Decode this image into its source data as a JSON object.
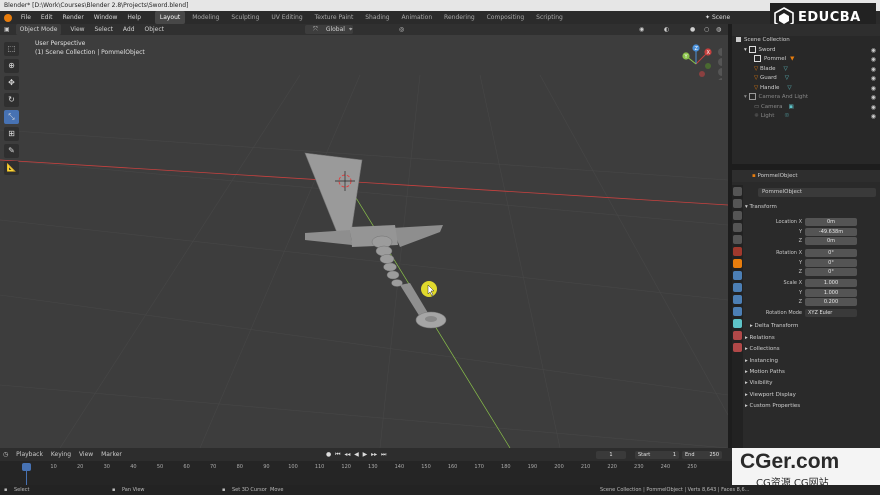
{
  "titlebar": {
    "text": "Blender* [D:\\Work\\Courses\\Blender 2.8\\Projects\\Sword.blend]"
  },
  "menu": [
    "File",
    "Edit",
    "Render",
    "Window",
    "Help"
  ],
  "workspaces": [
    {
      "label": "Layout",
      "active": true
    },
    {
      "label": "Modeling",
      "active": false
    },
    {
      "label": "Sculpting",
      "active": false
    },
    {
      "label": "UV Editing",
      "active": false
    },
    {
      "label": "Texture Paint",
      "active": false
    },
    {
      "label": "Shading",
      "active": false
    },
    {
      "label": "Animation",
      "active": false
    },
    {
      "label": "Rendering",
      "active": false
    },
    {
      "label": "Compositing",
      "active": false
    },
    {
      "label": "Scripting",
      "active": false
    }
  ],
  "scene_label": "Scene",
  "viewport_header": {
    "mode": "Object Mode",
    "items": [
      "View",
      "Select",
      "Add",
      "Object"
    ],
    "orientation": "Global"
  },
  "viewport_info": {
    "line1": "User Perspective",
    "line2": "(1) Scene Collection | PommelObject"
  },
  "gizmo": {
    "x": "X",
    "y": "Y",
    "z": "Z"
  },
  "outliner": {
    "rows": [
      {
        "label": "Scene Collection",
        "indent": 0
      },
      {
        "label": "Sword",
        "indent": 1
      },
      {
        "label": "Pommel",
        "indent": 2
      },
      {
        "label": "Blade",
        "indent": 2
      },
      {
        "label": "Guard",
        "indent": 2
      },
      {
        "label": "Handle",
        "indent": 2
      },
      {
        "label": "Camera And Light",
        "indent": 1
      },
      {
        "label": "Camera",
        "indent": 2
      },
      {
        "label": "Light",
        "indent": 2
      }
    ]
  },
  "properties": {
    "object_header": "PommelObject",
    "object_name": "PommelObject",
    "transform_title": "Transform",
    "location_label": "Location X",
    "location": [
      "0m",
      "-49.638m",
      "0m"
    ],
    "rotation_label": "Rotation X",
    "rotation": [
      "0°",
      "0°",
      "0°"
    ],
    "scale_label": "Scale X",
    "scale": [
      "1.000",
      "1.000",
      "0.200"
    ],
    "axis_y": "Y",
    "axis_z": "Z",
    "rotation_mode_label": "Rotation Mode",
    "rotation_mode": "XYZ Euler",
    "delta": "Delta Transform",
    "panels": [
      "Relations",
      "Collections",
      "Instancing",
      "Motion Paths",
      "Visibility",
      "Viewport Display",
      "Custom Properties"
    ]
  },
  "timeline": {
    "menus": [
      "Playback",
      "Keying",
      "View",
      "Marker"
    ],
    "current_frame": "1",
    "start_label": "Start",
    "start": "1",
    "end_label": "End",
    "end": "250",
    "ticks": [
      "1",
      "10",
      "20",
      "30",
      "40",
      "50",
      "60",
      "70",
      "80",
      "90",
      "100",
      "110",
      "120",
      "130",
      "140",
      "150",
      "160",
      "170",
      "180",
      "190",
      "200",
      "210",
      "220",
      "230",
      "240",
      "250"
    ]
  },
  "statusbar": {
    "select": "Select",
    "pan": "Pan View",
    "cursor": "Set 3D Cursor",
    "move": "Move",
    "stats": "Scene Collection | PommelObject | Verts 8,643 | Faces 8,6..."
  },
  "watermark": {
    "brand": "EDUCBA",
    "site": "CGer.com",
    "site_cn": "CG资源 CG网站"
  },
  "colors": {
    "accent": "#4772b3",
    "orange": "#e87d0d",
    "x_axis": "#c8413f",
    "y_axis": "#8bc34a",
    "z_axis": "#4a90d9",
    "cursor_yellow": "#f2ea2b"
  }
}
